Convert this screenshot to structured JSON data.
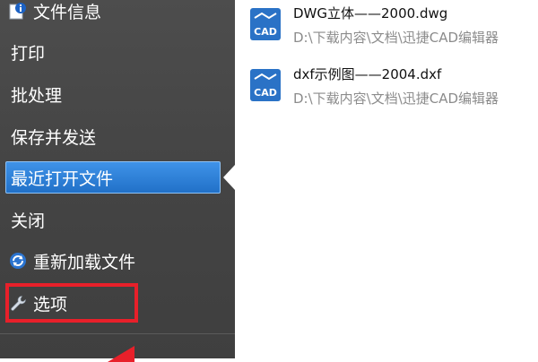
{
  "sidebar": {
    "items": [
      {
        "label": "文件信息",
        "icon": "info-icon"
      },
      {
        "label": "打印"
      },
      {
        "label": "批处理"
      },
      {
        "label": "保存并发送"
      },
      {
        "label": "最近打开文件",
        "active": true
      },
      {
        "label": "关闭"
      },
      {
        "label": "重新加载文件",
        "icon": "reload-icon"
      },
      {
        "label": "选项",
        "icon": "wrench-icon",
        "highlighted": true
      }
    ]
  },
  "recent_files": [
    {
      "name": "DWG立体——2000.dwg",
      "path": "D:\\下载内容\\文档\\迅捷CAD编辑器",
      "icon": "cad-file-icon",
      "icon_text": "CAD"
    },
    {
      "name": "dxf示例图——2004.dxf",
      "path": "D:\\下载内容\\文档\\迅捷CAD编辑器",
      "icon": "cad-file-icon",
      "icon_text": "CAD"
    }
  ],
  "colors": {
    "sidebar_bg": "#474747",
    "active_item": "#2f84dc",
    "highlight": "#e8202a",
    "cad_icon": "#2a72c6"
  }
}
